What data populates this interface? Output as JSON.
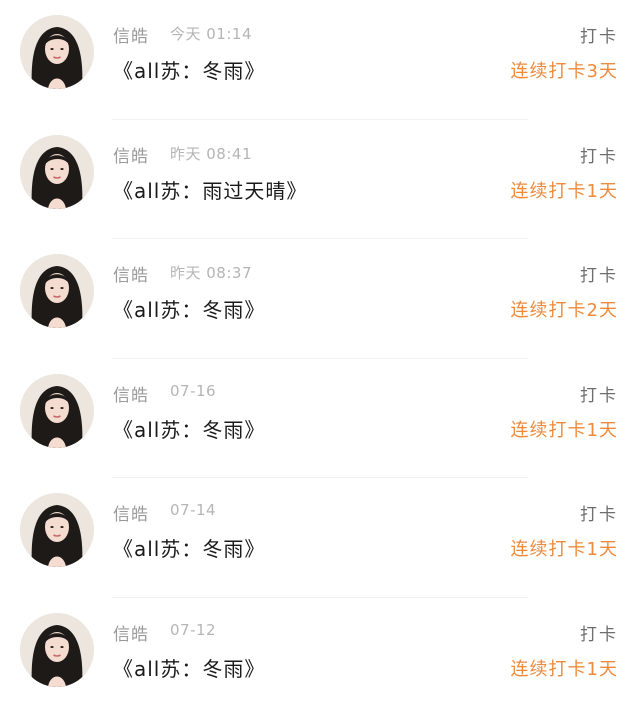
{
  "items": [
    {
      "name": "信皓",
      "time": "今天 01:14",
      "title": "《all苏：冬雨》",
      "tag": "打卡",
      "streak": "连续打卡3天",
      "avatar": "avatar-portrait-icon"
    },
    {
      "name": "信皓",
      "time": "昨天 08:41",
      "title": "《all苏：雨过天晴》",
      "tag": "打卡",
      "streak": "连续打卡1天",
      "avatar": "avatar-portrait-icon"
    },
    {
      "name": "信皓",
      "time": "昨天 08:37",
      "title": "《all苏：冬雨》",
      "tag": "打卡",
      "streak": "连续打卡2天",
      "avatar": "avatar-portrait-icon"
    },
    {
      "name": "信皓",
      "time": "07-16",
      "title": "《all苏：冬雨》",
      "tag": "打卡",
      "streak": "连续打卡1天",
      "avatar": "avatar-portrait-icon"
    },
    {
      "name": "信皓",
      "time": "07-14",
      "title": "《all苏：冬雨》",
      "tag": "打卡",
      "streak": "连续打卡1天",
      "avatar": "avatar-portrait-icon"
    },
    {
      "name": "信皓",
      "time": "07-12",
      "title": "《all苏：冬雨》",
      "tag": "打卡",
      "streak": "连续打卡1天",
      "avatar": "avatar-portrait-icon"
    }
  ],
  "colors": {
    "accent": "#ee8a3c",
    "name": "#9a9a9a",
    "time": "#b5b5b5",
    "title": "#1a1a1a",
    "tag": "#6e6e6e"
  }
}
